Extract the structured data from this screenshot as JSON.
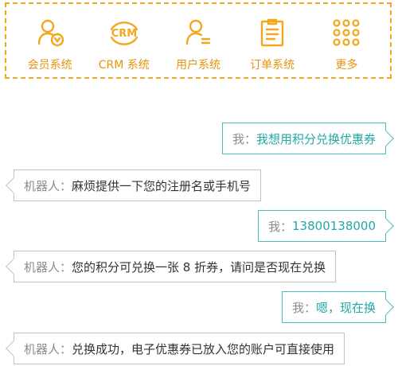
{
  "colors": {
    "accent": "#f2a71c",
    "user_border": "#4cbcba",
    "user_text": "#23a8a5",
    "bot_border": "#c2c2c2"
  },
  "nav": {
    "items": [
      {
        "label": "会员系统",
        "icon": "member-icon"
      },
      {
        "label": "CRM 系统",
        "icon": "crm-icon",
        "icon_text": "CRM"
      },
      {
        "label": "用户系统",
        "icon": "user-icon"
      },
      {
        "label": "订单系统",
        "icon": "order-icon"
      },
      {
        "label": "更多",
        "icon": "more-icon"
      }
    ]
  },
  "chat": {
    "messages": [
      {
        "role": "user",
        "speaker": "我：",
        "text": "我想用积分兑换优惠券"
      },
      {
        "role": "bot",
        "speaker": "机器人：",
        "text": "麻烦提供一下您的注册名或手机号"
      },
      {
        "role": "user",
        "speaker": "我：",
        "text": "13800138000"
      },
      {
        "role": "bot",
        "speaker": "机器人：",
        "text": "您的积分可兑换一张 8 折券，请问是否现在兑换"
      },
      {
        "role": "user",
        "speaker": "我：",
        "text": "嗯，现在换"
      },
      {
        "role": "bot",
        "speaker": "机器人：",
        "text": "兑换成功，电子优惠券已放入您的账户可直接使用"
      }
    ]
  }
}
